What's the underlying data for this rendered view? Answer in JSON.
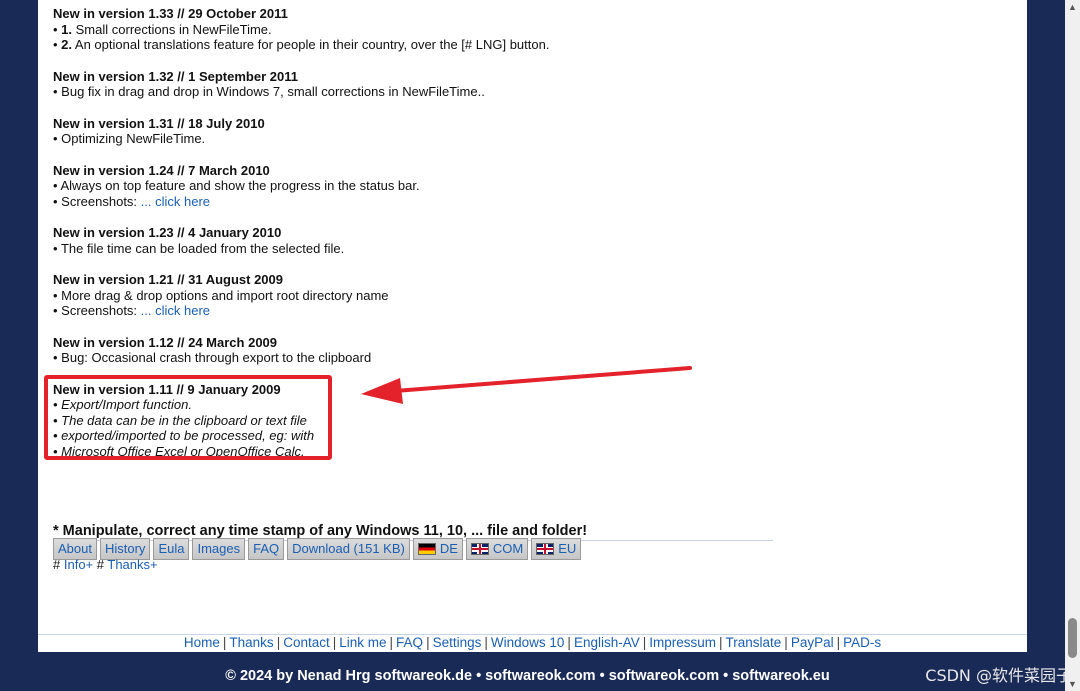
{
  "entries": [
    {
      "head": "New in version 1.33 // 29 October 2011",
      "lines": [
        {
          "num": "1.",
          "text": "Small corrections in NewFileTime."
        },
        {
          "num": "2.",
          "text": "An optional translations feature for people in their country, over the [# LNG] button."
        }
      ]
    },
    {
      "head": "New in version 1.32 // 1 September 2011",
      "lines": [
        {
          "text": "Bug fix in drag and drop in Windows 7, small corrections in NewFileTime.."
        }
      ]
    },
    {
      "head": "New in version 1.31 // 18 July 2010",
      "lines": [
        {
          "text": "Optimizing NewFileTime."
        }
      ]
    },
    {
      "head": "New in version 1.24 // 7 March 2010",
      "lines": [
        {
          "text": "Always on top feature and show the progress in the status bar."
        },
        {
          "text": "Screenshots:",
          "link": "... click here"
        }
      ]
    },
    {
      "head": "New in version 1.23 // 4 January 2010",
      "lines": [
        {
          "text": "The file time can be loaded from the selected file."
        }
      ]
    },
    {
      "head": "New in version 1.21 // 31 August 2009",
      "lines": [
        {
          "text": "More drag & drop options and import root directory name"
        },
        {
          "text": "Screenshots:",
          "link": "... click here"
        }
      ]
    },
    {
      "head": "New in version 1.12 // 24 March 2009",
      "lines": [
        {
          "text": "Bug: Occasional crash through export to the clipboard"
        }
      ]
    },
    {
      "head": "New in version 1.11 // 9 January 2009",
      "italic": true,
      "lines": [
        {
          "text": "Export/Import function."
        },
        {
          "text": "The data can be in the clipboard or text file"
        },
        {
          "text": "exported/imported to be processed, eg: with"
        },
        {
          "text": "Microsoft Office Excel or OpenOffice Calc."
        }
      ]
    }
  ],
  "tagline": "* Manipulate, correct any time stamp of any Windows 11, 10, ... file and folder!",
  "nav_buttons": [
    {
      "label": "About"
    },
    {
      "label": "History"
    },
    {
      "label": "Eula"
    },
    {
      "label": "Images"
    },
    {
      "label": "FAQ"
    },
    {
      "label": "Download (151 KB)"
    },
    {
      "label": "DE",
      "flag": "de"
    },
    {
      "label": "COM",
      "flag": "uk"
    },
    {
      "label": "EU",
      "flag": "uk"
    }
  ],
  "subnav": {
    "prefix1": "#",
    "link1": "Info+",
    "prefix2": "#",
    "link2": "Thanks+"
  },
  "footer_links": [
    "Home",
    "Thanks",
    "Contact",
    "Link me",
    "FAQ",
    "Settings",
    "Windows 10",
    "English-AV",
    "Impressum",
    "Translate",
    "PayPal",
    "PAD-s"
  ],
  "copyright": "© 2024 by Nenad Hrg softwareok.de • softwareok.com • softwareok.com • softwareok.eu",
  "watermark": "CSDN @软件菜园子",
  "colors": {
    "highlight": "#e4222b",
    "link": "#1a5fb4",
    "background": "#1a2a57"
  }
}
